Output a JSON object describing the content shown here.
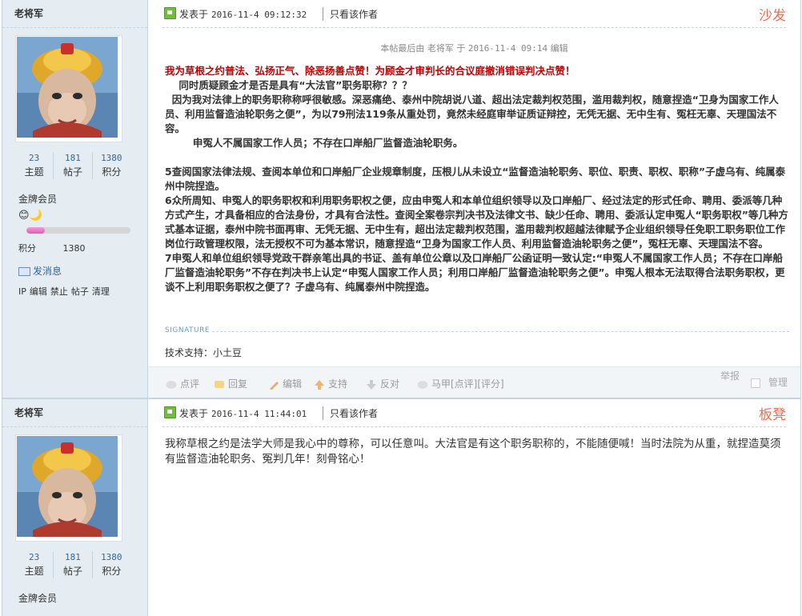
{
  "posts": [
    {
      "author": {
        "name": "老将军",
        "stats": [
          {
            "value": "23",
            "label": "主题"
          },
          {
            "value": "181",
            "label": "帖子"
          },
          {
            "value": "1380",
            "label": "积分"
          }
        ],
        "rank": "金牌会员",
        "medals": "😊🌙",
        "level_progress": 0.18,
        "credits_label": "积分",
        "credits_value": "1380",
        "message_label": "发消息",
        "admin_links": [
          "IP",
          "编辑",
          "禁止",
          "帖子",
          "清理"
        ]
      },
      "header": {
        "posted_label": "发表于",
        "posted_time": "2016-11-4 09:12:32",
        "only_author": "只看该作者",
        "floor": "沙发"
      },
      "edit_note": {
        "prefix": "本帖最后由",
        "editor": "老将军",
        "middle": "于",
        "time": "2016-11-4 09:14",
        "suffix": "编辑"
      },
      "body": {
        "title_line": "我为草根之约普法、弘扬正气、除恶扬善点赞！为顾金才审判长的合议庭撤消错误判决点赞！",
        "line1": "    同时质疑顾金才是否是具有“大法官”职务职称？？？",
        "line2": "  因为我对法律上的职务职称称呼很敏感。深恶痛绝、泰州中院胡说八道、超出法定裁判权范围，滥用裁判权，随意捏造“卫身为国家工作人员、利用监督造油轮职务之便”，为以79刑法119条从重处罚，竟然未经庭审举证质证辩控，无凭无据、无中生有、冤枉无辜、天理国法不容。",
        "line3": "        申冤人不属国家工作人员；不存在口岸船厂监督造油轮职务。",
        "para5": "5查阅国家法律法规、查阅本单位和口岸船厂企业规章制度，压根儿从未设立“监督造油轮职务、职位、职责、职权、职称”子虚乌有、纯属泰州中院捏造。",
        "para6": "6众所周知、申冤人的职务职权和利用职务职权之便，应由申冤人和本单位组织领导以及口岸船厂、经过法定的形式任命、聘用、委派等几种方式产生，才具备相应的合法身份，才具有合法性。查阅全案卷宗判决书及法律文书、缺少任命、聘用、委派认定申冤人“职务职权”等几种方式基本证据，泰州中院书面再审、无凭无据、无中生有，超出法定裁判权范围，滥用裁判权超越法律赋予企业组织领导任免职工职务职位工作岗位行政管理权限，法无授权不可为基本常识，随意捏造“卫身为国家工作人员、利用监督造油轮职务之便”，冤枉无辜、天理国法不容。",
        "para7": "7申冤人和单位组织领导党政干群亲笔出具的书证、盖有单位公章以及口岸船厂公函证明一致认定:“申冤人不属国家工作人员；不存在口岸船厂监督造油轮职务”不存在判决书上认定“申冤人国家工作人员；利用口岸船厂监督造油轮职务之便”。申冤人根本无法取得合法职务职权，更谈不上利用职务职权之便了？子虚乌有、纯属泰州中院捏造。"
      },
      "signature": {
        "label": "SIGNATURE",
        "text": "技术支持：小土豆"
      },
      "actions": {
        "rate": "点评",
        "reply": "回复",
        "edit": "编辑",
        "support": "支持",
        "oppose": "反对",
        "majia": "马甲[点评][评分]",
        "report": "举报",
        "manage": "管理"
      }
    },
    {
      "author": {
        "name": "老将军",
        "stats": [
          {
            "value": "23",
            "label": "主题"
          },
          {
            "value": "181",
            "label": "帖子"
          },
          {
            "value": "1380",
            "label": "积分"
          }
        ],
        "rank": "金牌会员"
      },
      "header": {
        "posted_label": "发表于",
        "posted_time": "2016-11-4 11:44:01",
        "only_author": "只看该作者",
        "floor": "板凳"
      },
      "body": {
        "text": "我称草根之约是法学大师是我心中的尊称，可以任意叫。大法官是有这个职务职称的，不能随便喊！当时法院为从重，就捏造莫须有监督造油轮职务、冤判几年！刻骨铭心！"
      }
    }
  ],
  "colors": {
    "author_bg": "#e5edf2",
    "border": "#c2d5e3",
    "floor": "#f26c4f",
    "link": "#336699",
    "title_red": "#c00000"
  }
}
